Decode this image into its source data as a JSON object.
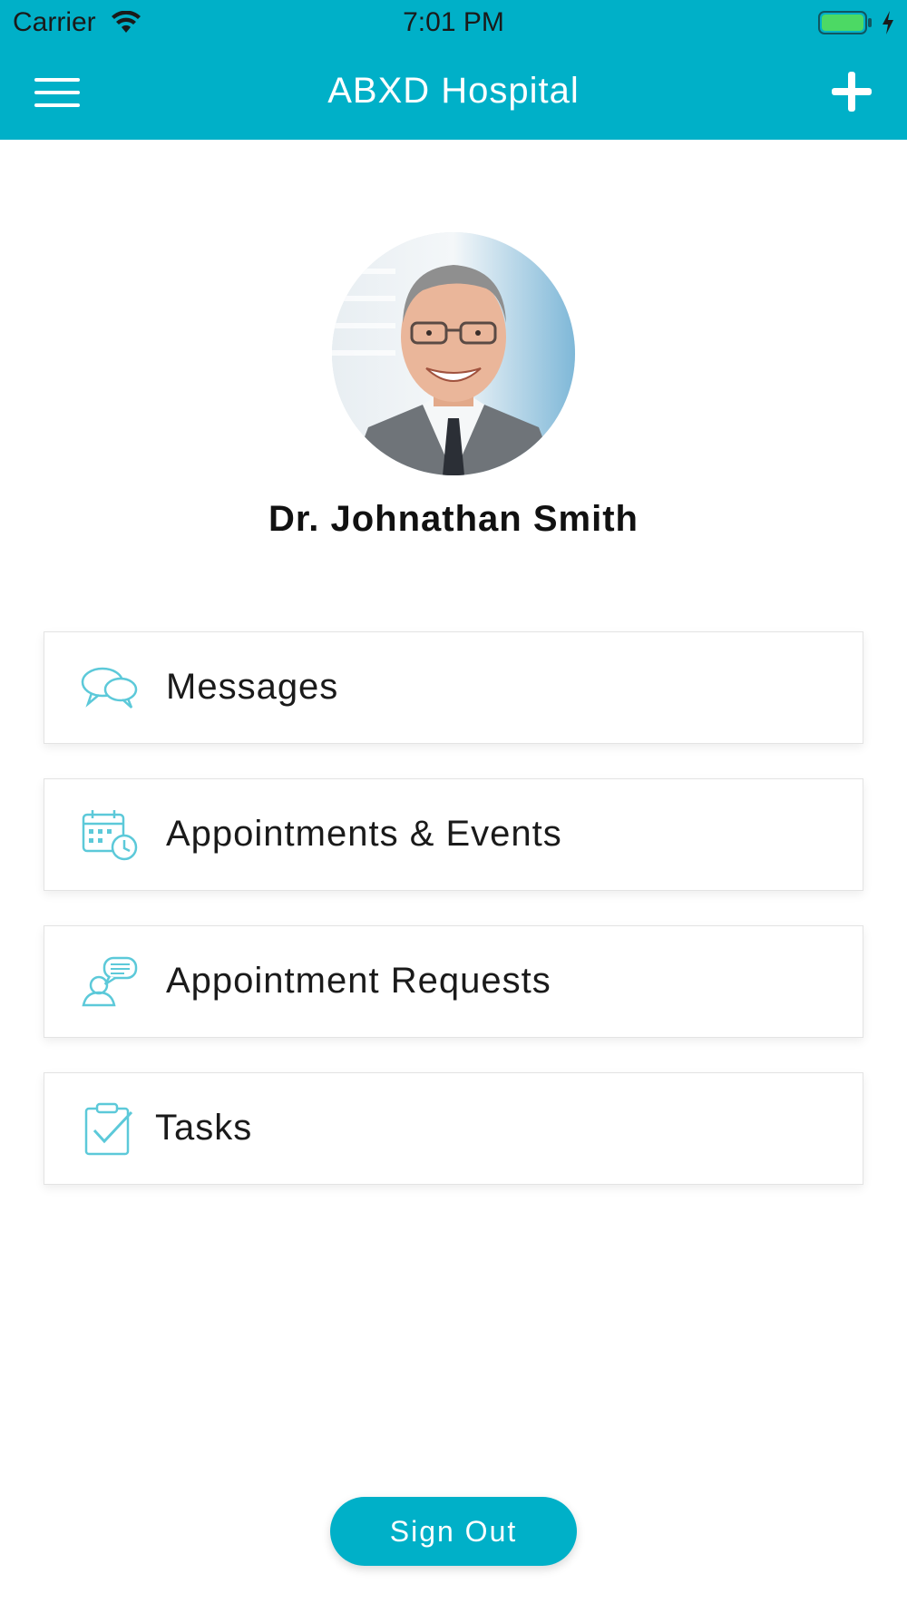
{
  "status_bar": {
    "carrier": "Carrier",
    "time": "7:01 PM",
    "wifi_icon": "wifi-icon",
    "battery_icon": "battery-charging-icon"
  },
  "nav_bar": {
    "title": "ABXD Hospital",
    "left_icon": "hamburger-menu-icon",
    "right_icon": "plus-icon",
    "background_color": "#00b0c8"
  },
  "profile": {
    "name": "Dr. Johnathan Smith",
    "avatar_icon": "doctor-avatar"
  },
  "menu": {
    "items": [
      {
        "label": "Messages",
        "icon": "chat-bubbles-icon"
      },
      {
        "label": "Appointments & Events",
        "icon": "calendar-clock-icon"
      },
      {
        "label": "Appointment Requests",
        "icon": "person-speech-icon"
      },
      {
        "label": "Tasks",
        "icon": "clipboard-check-icon"
      }
    ]
  },
  "footer": {
    "signout_label": "Sign Out"
  },
  "colors": {
    "accent": "#00b0c8",
    "icon": "#5cc9d9",
    "text": "#1a1a1a"
  }
}
